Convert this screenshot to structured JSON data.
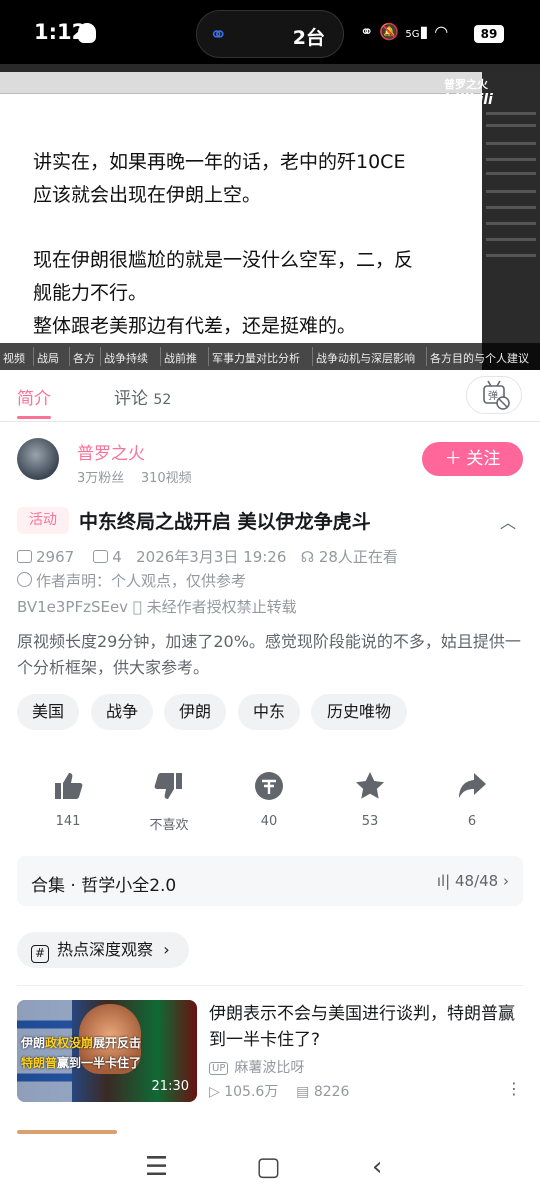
{
  "status_bar": {
    "time": "1:12",
    "island_count": "2台",
    "signal": "5G",
    "battery": "89"
  },
  "video": {
    "watermark": "普罗之火",
    "logo": "bilibili",
    "text_lines": [
      "讲实在，如果再晚一年的话，老中的歼10CE",
      "应该就会出现在伊朗上空。",
      "现在伊朗很尴尬的就是一没什么空军，二，反",
      "舰能力不行。",
      "整体跟老美那边有代差，还是挺难的。"
    ],
    "chapters": [
      "视频",
      "战局",
      "各方",
      "战争持续",
      "战前推",
      "军事力量对比分析",
      "战争动机与深层影响",
      "各方目的与个人建议"
    ]
  },
  "tabs": {
    "intro": "简介",
    "comments": "评论",
    "comments_count": "52",
    "danmaku_icon": "danmaku-off-icon"
  },
  "uploader": {
    "name": "普罗之火",
    "followers": "3万粉丝",
    "videos": "310视频",
    "follow_label": "＋ 关注"
  },
  "video_info": {
    "badge": "活动",
    "title": "中东终局之战开启 美以伊龙争虎斗",
    "views": "2967",
    "danmaku_count": "4",
    "date": "2026年3月3日 19:26",
    "watching": "28人正在看",
    "declaration": "作者声明：个人观点，仅供参考",
    "bvid": "BV1e3PFzSEev",
    "no_reprint": "未经作者授权禁止转载",
    "description": "原视频长度29分钟，加速了20%。感觉现阶段能说的不多，姑且提供一个分析框架，供大家参考。"
  },
  "tags": [
    "美国",
    "战争",
    "伊朗",
    "中东",
    "历史唯物"
  ],
  "actions": {
    "like": "141",
    "dislike": "不喜欢",
    "coin": "40",
    "favorite": "53",
    "share": "6"
  },
  "collection": {
    "label": "合集 · 哲学小全2.0",
    "progress": "48/48"
  },
  "hot_topic": "热点深度观察",
  "related": [
    {
      "title": "伊朗表示不会与美国进行谈判，特朗普赢到一半卡住了?",
      "uploader": "麻薯波比呀",
      "up_badge": "UP",
      "views": "105.6万",
      "danmaku": "8226",
      "duration": "21:30",
      "thumb_line1_a": "伊朗",
      "thumb_line1_b": "政权没崩",
      "thumb_line1_c": "展开反击",
      "thumb_line2_a": "特朗普",
      "thumb_line2_b": "赢到一半卡住了"
    }
  ]
}
